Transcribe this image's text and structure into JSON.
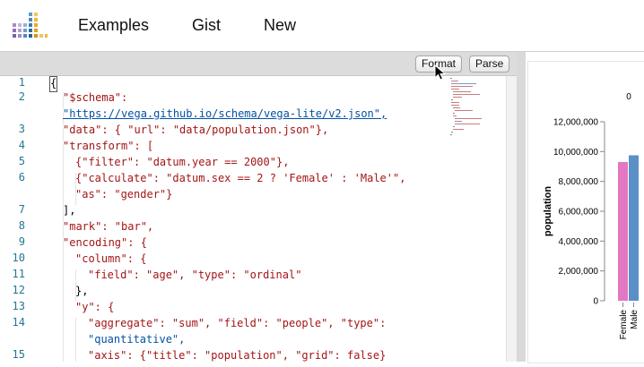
{
  "header": {
    "nav": [
      "Examples",
      "Gist",
      "New"
    ]
  },
  "toolbar": {
    "format_label": "Format",
    "parse_label": "Parse"
  },
  "editor": {
    "line_numbers": [
      "1",
      "2",
      "3",
      "4",
      "5",
      "6",
      "7",
      "8",
      "9",
      "10",
      "11",
      "12",
      "13",
      "14",
      "15"
    ],
    "lines": [
      "{",
      "\"$schema\":",
      "\"https://vega.github.io/schema/vega-lite/v2.json\",",
      "\"data\": { \"url\": \"data/population.json\"},",
      "\"transform\": [",
      "{\"filter\": \"datum.year == 2000\"},",
      "{\"calculate\": \"datum.sex == 2 ? 'Female' : 'Male'\",",
      "\"as\": \"gender\"}",
      "],",
      "\"mark\": \"bar\",",
      "\"encoding\": {",
      "\"column\": {",
      "\"field\": \"age\", \"type\": \"ordinal\"",
      "},",
      "\"y\": {",
      "\"aggregate\": \"sum\", \"field\": \"people\", \"type\":",
      "\"quantitative\",",
      "\"axis\": {\"title\": \"population\", \"grid\": false}"
    ]
  },
  "chart_data": {
    "type": "bar",
    "column_header": "0",
    "categories": [
      "Female",
      "Male"
    ],
    "values": [
      9300000,
      9750000
    ],
    "colors": [
      "#e377c2",
      "#5b8fc9"
    ],
    "ylabel": "population",
    "yticks": [
      "0",
      "2,000,000",
      "4,000,000",
      "6,000,000",
      "8,000,000",
      "10,000,000",
      "12,000,000"
    ],
    "ylim": [
      0,
      12000000
    ]
  }
}
